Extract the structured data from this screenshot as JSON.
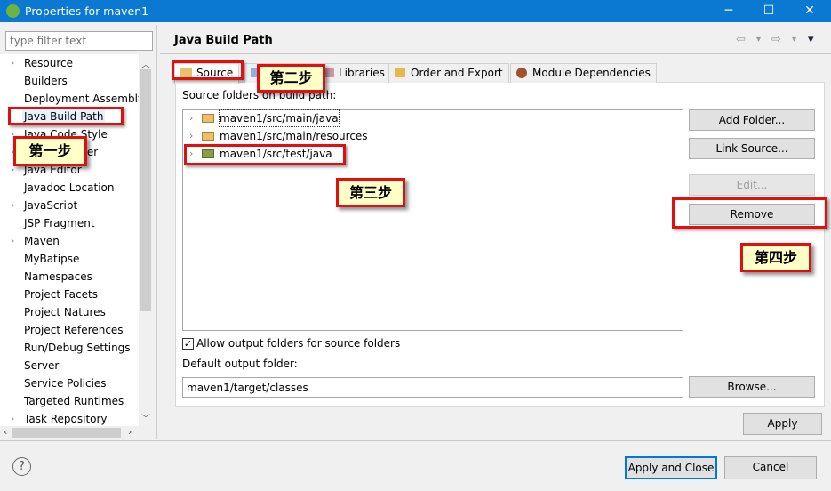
{
  "window": {
    "title": "Properties for maven1",
    "minimize": "─",
    "maximize": "☐",
    "close": "✕"
  },
  "filter": {
    "placeholder": "type filter text"
  },
  "sidebar": {
    "items": [
      {
        "label": "Resource",
        "expandable": true
      },
      {
        "label": "Builders",
        "expandable": false
      },
      {
        "label": "Deployment Assembly",
        "expandable": false
      },
      {
        "label": "Java Build Path",
        "expandable": false,
        "selected": true
      },
      {
        "label": "Java Code Style",
        "expandable": true
      },
      {
        "label": "Java Compiler",
        "expandable": true
      },
      {
        "label": "Java Editor",
        "expandable": true
      },
      {
        "label": "Javadoc Location",
        "expandable": false
      },
      {
        "label": "JavaScript",
        "expandable": true
      },
      {
        "label": "JSP Fragment",
        "expandable": false
      },
      {
        "label": "Maven",
        "expandable": true
      },
      {
        "label": "MyBatipse",
        "expandable": false
      },
      {
        "label": "Namespaces",
        "expandable": false
      },
      {
        "label": "Project Facets",
        "expandable": false
      },
      {
        "label": "Project Natures",
        "expandable": false
      },
      {
        "label": "Project References",
        "expandable": false
      },
      {
        "label": "Run/Debug Settings",
        "expandable": false
      },
      {
        "label": "Server",
        "expandable": false
      },
      {
        "label": "Service Policies",
        "expandable": false
      },
      {
        "label": "Targeted Runtimes",
        "expandable": false
      },
      {
        "label": "Task Repository",
        "expandable": true
      }
    ]
  },
  "page": {
    "title": "Java Build Path",
    "nav": {
      "back": "⇦",
      "forward": "⇨",
      "dropdown": "▾"
    }
  },
  "tabs": [
    {
      "label": "Source",
      "icon": "source-folder-icon"
    },
    {
      "label": "",
      "icon": "projects-icon"
    },
    {
      "label": "Libraries",
      "icon": "libraries-icon"
    },
    {
      "label": "Order and Export",
      "icon": "order-export-icon"
    },
    {
      "label": "Module Dependencies",
      "icon": "module-icon"
    }
  ],
  "source": {
    "label": "Source folders on build path:",
    "folders": [
      "maven1/src/main/java",
      "maven1/src/main/resources",
      "maven1/src/test/java"
    ],
    "buttons": {
      "add": "Add Folder...",
      "link": "Link Source...",
      "edit": "Edit...",
      "remove": "Remove"
    },
    "allow_output": {
      "label": "Allow output folders for source folders",
      "checked": true
    },
    "output_label": "Default output folder:",
    "output_value": "maven1/target/classes",
    "browse": "Browse..."
  },
  "footer": {
    "apply": "Apply",
    "apply_close": "Apply and Close",
    "cancel": "Cancel",
    "help": "?"
  },
  "annotations": {
    "step1": "第一步",
    "step2": "第二步",
    "step3": "第三步",
    "step4": "第四步"
  },
  "colors": {
    "titlebar": "#0b78d2",
    "highlight": "#e01010",
    "note": "#ffffc8"
  }
}
